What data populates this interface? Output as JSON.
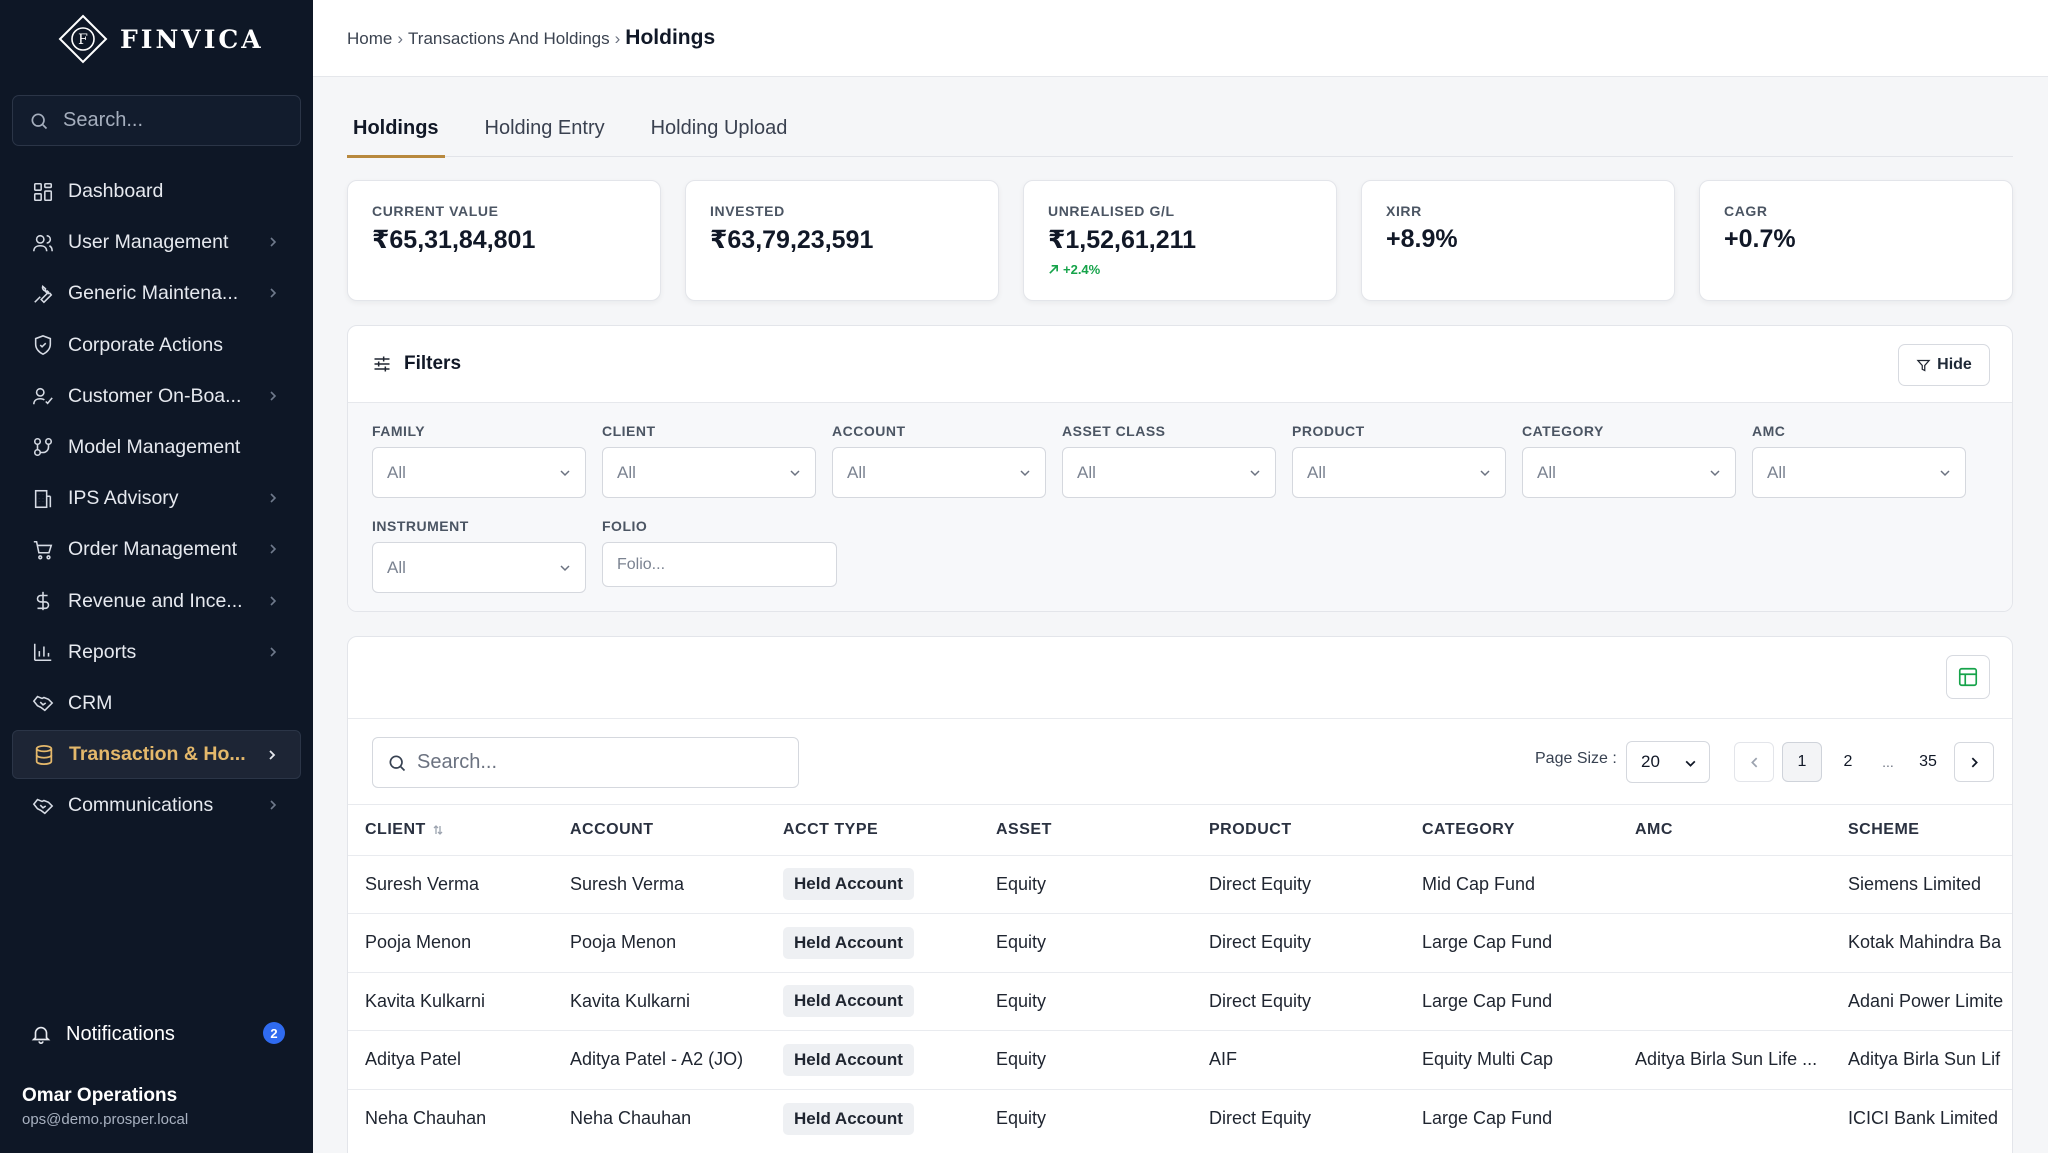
{
  "brand": {
    "name": "FINVICA",
    "mark": "F"
  },
  "sidebar": {
    "search_placeholder": "Search...",
    "items": [
      {
        "label": "Dashboard",
        "icon": "dashboard-icon",
        "has_children": false
      },
      {
        "label": "User Management",
        "icon": "users-icon",
        "has_children": true
      },
      {
        "label": "Generic Maintena...",
        "icon": "wrench-icon",
        "has_children": true
      },
      {
        "label": "Corporate Actions",
        "icon": "shield-icon",
        "has_children": false
      },
      {
        "label": "Customer On-Boa...",
        "icon": "user-check-icon",
        "has_children": true
      },
      {
        "label": "Model Management",
        "icon": "model-icon",
        "has_children": false
      },
      {
        "label": "IPS Advisory",
        "icon": "building-icon",
        "has_children": true
      },
      {
        "label": "Order Management",
        "icon": "cart-icon",
        "has_children": true
      },
      {
        "label": "Revenue and Ince...",
        "icon": "dollar-icon",
        "has_children": true
      },
      {
        "label": "Reports",
        "icon": "bar-chart-icon",
        "has_children": true
      },
      {
        "label": "CRM",
        "icon": "handshake-icon",
        "has_children": false
      },
      {
        "label": "Transaction & Ho...",
        "icon": "database-icon",
        "has_children": true,
        "active": true
      },
      {
        "label": "Communications",
        "icon": "chat-icon",
        "has_children": true
      }
    ],
    "notifications": {
      "label": "Notifications",
      "count": "2"
    },
    "user": {
      "name": "Omar Operations",
      "email": "ops@demo.prosper.local"
    }
  },
  "breadcrumb": {
    "items": [
      "Home",
      "Transactions And Holdings"
    ],
    "current": "Holdings",
    "separator": "›"
  },
  "tabs": [
    {
      "label": "Holdings",
      "active": true
    },
    {
      "label": "Holding Entry",
      "active": false
    },
    {
      "label": "Holding Upload",
      "active": false
    }
  ],
  "stats": [
    {
      "label": "CURRENT VALUE",
      "value": "₹65,31,84,801"
    },
    {
      "label": "INVESTED",
      "value": "₹63,79,23,591"
    },
    {
      "label": "UNREALISED G/L",
      "value": "₹1,52,61,211",
      "change": "+2.4%"
    },
    {
      "label": "XIRR",
      "value": "+8.9%"
    },
    {
      "label": "CAGR",
      "value": "+0.7%"
    }
  ],
  "filters": {
    "title": "Filters",
    "hide_label": "Hide",
    "fields": [
      {
        "label": "FAMILY",
        "value": "All"
      },
      {
        "label": "CLIENT",
        "value": "All"
      },
      {
        "label": "ACCOUNT",
        "value": "All"
      },
      {
        "label": "ASSET CLASS",
        "value": "All"
      },
      {
        "label": "PRODUCT",
        "value": "All"
      },
      {
        "label": "CATEGORY",
        "value": "All"
      },
      {
        "label": "AMC",
        "value": "All"
      },
      {
        "label": "INSTRUMENT",
        "value": "All"
      }
    ],
    "folio": {
      "label": "FOLIO",
      "placeholder": "Folio..."
    }
  },
  "table": {
    "search_placeholder": "Search...",
    "page_size_label": "Page Size :",
    "page_size": "20",
    "pages": [
      "1",
      "2",
      "...",
      "35"
    ],
    "columns": [
      "CLIENT",
      "ACCOUNT",
      "ACCT TYPE",
      "ASSET",
      "PRODUCT",
      "CATEGORY",
      "AMC",
      "SCHEME"
    ],
    "rows": [
      [
        "Suresh Verma",
        "Suresh Verma",
        "Held Account",
        "Equity",
        "Direct Equity",
        "Mid Cap Fund",
        "",
        "Siemens Limited"
      ],
      [
        "Pooja Menon",
        "Pooja Menon",
        "Held Account",
        "Equity",
        "Direct Equity",
        "Large Cap Fund",
        "",
        "Kotak Mahindra Ba"
      ],
      [
        "Kavita Kulkarni",
        "Kavita Kulkarni",
        "Held Account",
        "Equity",
        "Direct Equity",
        "Large Cap Fund",
        "",
        "Adani Power Limite"
      ],
      [
        "Aditya Patel",
        "Aditya Patel - A2 (JO)",
        "Held Account",
        "Equity",
        "AIF",
        "Equity Multi Cap",
        "Aditya Birla Sun Life ...",
        "Aditya Birla Sun Lif"
      ],
      [
        "Neha Chauhan",
        "Neha Chauhan",
        "Held Account",
        "Equity",
        "Direct Equity",
        "Large Cap Fund",
        "",
        "ICICI Bank Limited"
      ]
    ]
  },
  "colors": {
    "sidebar_bg": "#0e1726",
    "accent_gold": "#e4b86b",
    "tab_underline": "#b8893e",
    "positive": "#16a34a",
    "badge_blue": "#2f6bf0"
  }
}
